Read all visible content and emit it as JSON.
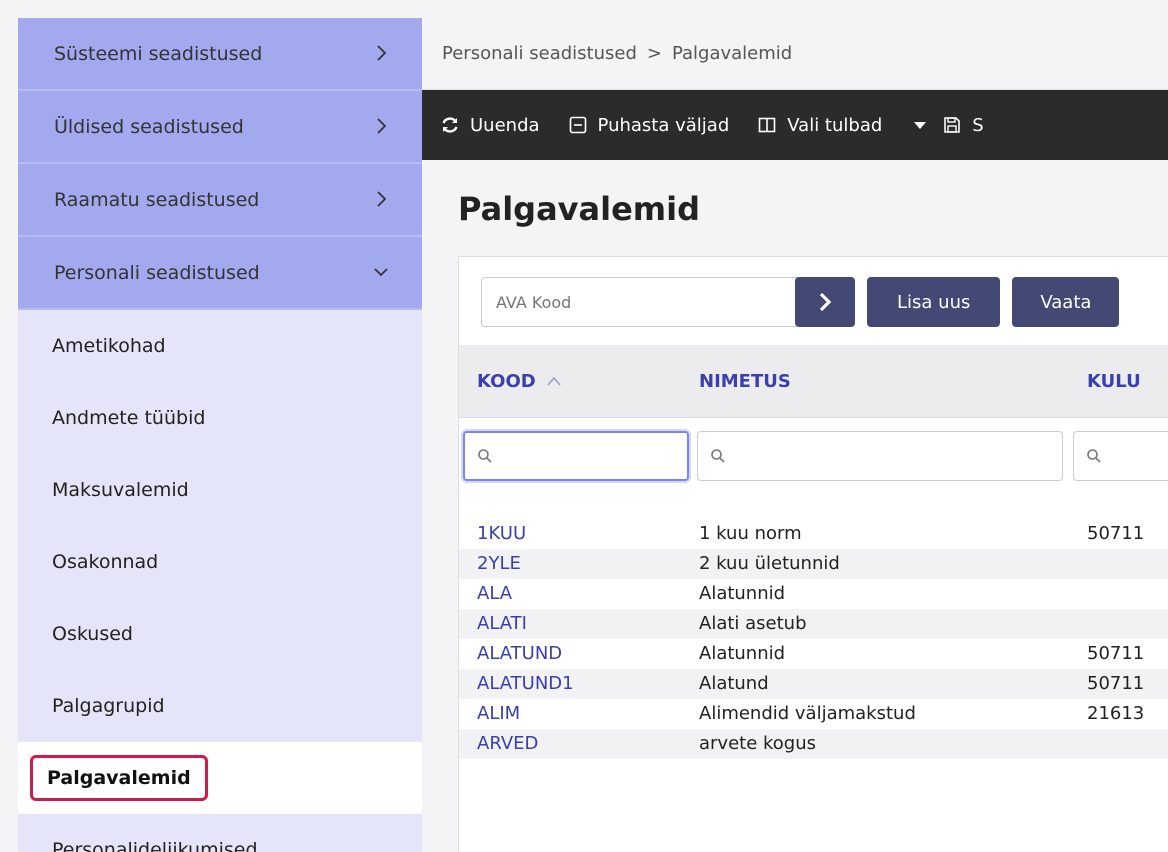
{
  "sidebar": {
    "groups": [
      {
        "label": "Süsteemi seadistused",
        "expanded": false
      },
      {
        "label": "Üldised seadistused",
        "expanded": false
      },
      {
        "label": "Raamatu seadistused",
        "expanded": false
      },
      {
        "label": "Personali seadistused",
        "expanded": true
      }
    ],
    "items": [
      {
        "label": "Ametikohad"
      },
      {
        "label": "Andmete tüübid"
      },
      {
        "label": "Maksuvalemid"
      },
      {
        "label": "Osakonnad"
      },
      {
        "label": "Oskused"
      },
      {
        "label": "Palgagrupid"
      },
      {
        "label": "Palgavalemid",
        "active": true
      },
      {
        "label": "Personalideliikumised"
      }
    ]
  },
  "breadcrumb": {
    "parent": "Personali seadistused",
    "separator": ">",
    "current": "Palgavalemid"
  },
  "toolbar": {
    "refresh": "Uuenda",
    "clear": "Puhasta väljad",
    "columns": "Vali tulbad",
    "save": "S"
  },
  "page": {
    "title": "Palgavalemid"
  },
  "open_bar": {
    "placeholder": "AVA Kood",
    "add_new": "Lisa uus",
    "view": "Vaata"
  },
  "table": {
    "headers": {
      "code": "KOOD",
      "name": "NIMETUS",
      "kulu": "KULU"
    },
    "rows": [
      {
        "code": "1KUU",
        "name": "1 kuu norm",
        "kulu": "50711"
      },
      {
        "code": "2YLE",
        "name": "2 kuu ületunnid",
        "kulu": ""
      },
      {
        "code": "ALA",
        "name": "Alatunnid",
        "kulu": ""
      },
      {
        "code": "ALATI",
        "name": "Alati asetub",
        "kulu": ""
      },
      {
        "code": "ALATUND",
        "name": "Alatunnid",
        "kulu": "50711"
      },
      {
        "code": "ALATUND1",
        "name": "Alatund",
        "kulu": "50711"
      },
      {
        "code": "ALIM",
        "name": "Alimendid väljamakstud",
        "kulu": "21613"
      },
      {
        "code": "ARVED",
        "name": "arvete kogus",
        "kulu": ""
      }
    ]
  },
  "colors": {
    "accent": "#3a3fb0",
    "sidebar_group": "#a3a9ef",
    "highlight": "#d11a4c",
    "toolbar": "#2b2b2b"
  }
}
